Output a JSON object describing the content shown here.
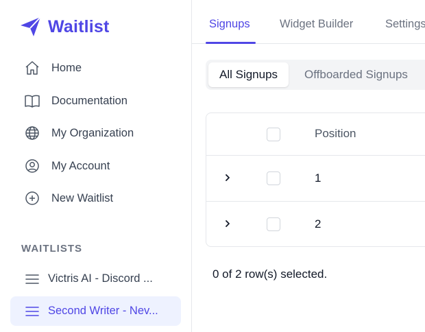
{
  "app": {
    "name": "Waitlist",
    "brand_color": "#4f46e5"
  },
  "sidebar": {
    "nav": [
      {
        "label": "Home",
        "icon": "home-icon"
      },
      {
        "label": "Documentation",
        "icon": "book-icon"
      },
      {
        "label": "My Organization",
        "icon": "globe-icon"
      },
      {
        "label": "My Account",
        "icon": "user-circle-icon"
      },
      {
        "label": "New Waitlist",
        "icon": "plus-circle-icon"
      }
    ],
    "section_title": "WAITLISTS",
    "waitlists": [
      {
        "label": "Victris AI - Discord ...",
        "icon": "menu-icon",
        "active": false
      },
      {
        "label": "Second Writer - Nev...",
        "icon": "menu-icon",
        "active": true
      }
    ]
  },
  "tabs": [
    {
      "label": "Signups",
      "active": true
    },
    {
      "label": "Widget Builder",
      "active": false
    },
    {
      "label": "Settings",
      "active": false
    }
  ],
  "segments": [
    {
      "label": "All Signups",
      "active": true
    },
    {
      "label": "Offboarded Signups",
      "active": false
    }
  ],
  "table": {
    "columns": [
      "Position"
    ],
    "rows": [
      {
        "position": "1"
      },
      {
        "position": "2"
      }
    ]
  },
  "footer": {
    "selection_text": "0 of 2 row(s) selected."
  }
}
